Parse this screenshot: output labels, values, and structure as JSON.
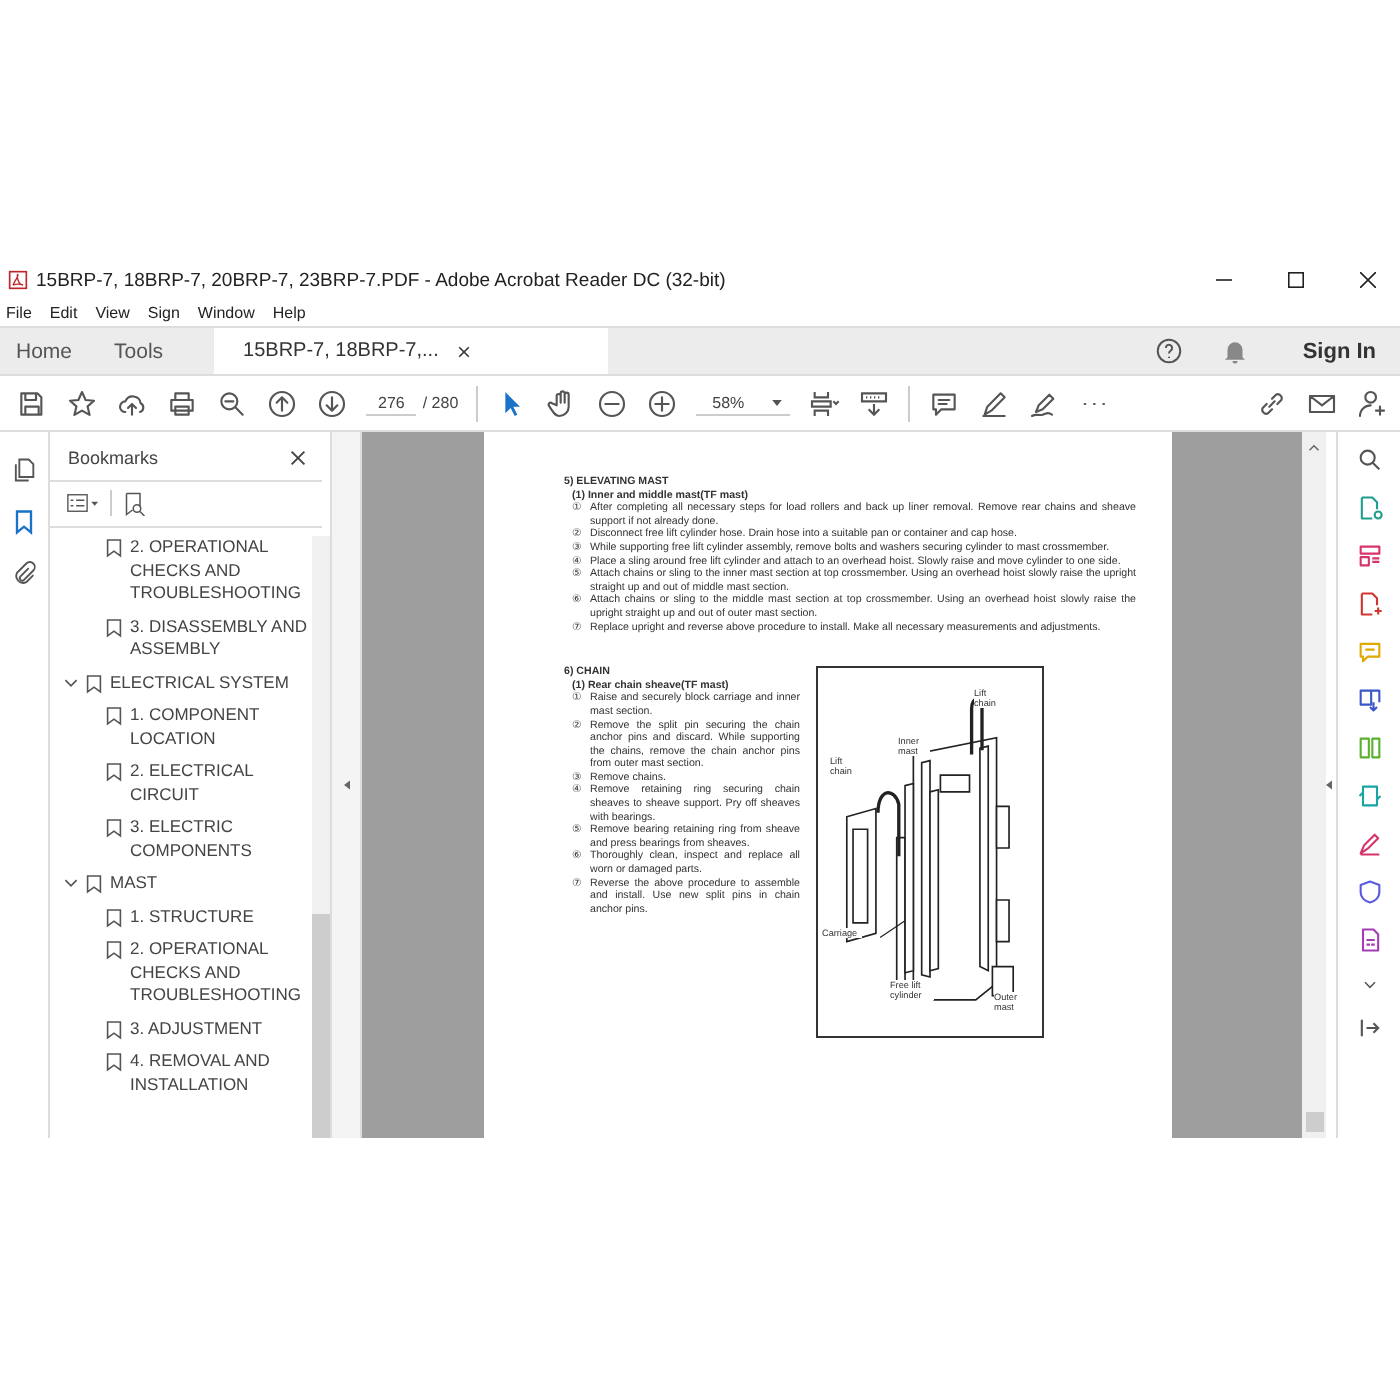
{
  "window": {
    "title": "15BRP-7, 18BRP-7, 20BRP-7, 23BRP-7.PDF - Adobe Acrobat Reader DC (32-bit)"
  },
  "menu": [
    "File",
    "Edit",
    "View",
    "Sign",
    "Window",
    "Help"
  ],
  "tabs": [
    {
      "label": "Home",
      "selected": false,
      "kind": "nav"
    },
    {
      "label": "Tools",
      "selected": false,
      "kind": "nav"
    },
    {
      "label": "15BRP-7, 18BRP-7,...",
      "selected": true,
      "kind": "document"
    }
  ],
  "sign_in": "Sign In",
  "toolbar": {
    "page": "276",
    "page_total": "/ 280",
    "zoom": "58%"
  },
  "bookmarks": {
    "title": "Bookmarks",
    "items": [
      {
        "children": [
          {
            "label": "2. OPERATIONAL CHECKS AND TROUBLESHOOTING"
          },
          {
            "label": "3. DISASSEMBLY AND ASSEMBLY"
          }
        ]
      },
      {
        "label": "ELECTRICAL SYSTEM",
        "expanded": true,
        "children": [
          {
            "label": "1. COMPONENT LOCATION"
          },
          {
            "label": "2. ELECTRICAL CIRCUIT"
          },
          {
            "label": "3. ELECTRIC COMPONENTS"
          }
        ]
      },
      {
        "label": "MAST",
        "expanded": true,
        "children": [
          {
            "label": "1. STRUCTURE"
          },
          {
            "label": "2. OPERATIONAL CHECKS AND TROUBLESHOOTING"
          },
          {
            "label": "3. ADJUSTMENT"
          },
          {
            "label": "4. REMOVAL AND INSTALLATION"
          }
        ]
      }
    ]
  },
  "page": {
    "sections": [
      {
        "heading": "5) ELEVATING MAST",
        "subheading": "(1) Inner and middle mast(TF mast)",
        "steps": [
          {
            "num": "①",
            "text": "After completing all necessary steps for load rollers and back up liner removal.  Remove rear chains and sheave support if not already done."
          },
          {
            "num": "②",
            "text": "Disconnect free lift cylinder hose.  Drain hose into a suitable pan or container and cap hose."
          },
          {
            "num": "③",
            "text": "While supporting free lift cylinder assembly, remove bolts and washers securing cylinder to mast crossmember."
          },
          {
            "num": "④",
            "text": "Place a sling around free lift cylinder and attach to an overhead hoist.  Slowly raise and move cylinder to one side."
          },
          {
            "num": "⑤",
            "text": "Attach chains or sling to the inner mast section at top crossmember.  Using an overhead hoist slowly raise the upright straight up and out of middle mast section."
          },
          {
            "num": "⑥",
            "text": "Attach chains or sling to the middle mast section at top crossmember.  Using an overhead hoist slowly raise the upright straight up and out of outer mast section."
          },
          {
            "num": "⑦",
            "text": "Replace upright and reverse above procedure to install.  Make all necessary measurements and adjustments."
          }
        ]
      },
      {
        "heading": "6) CHAIN",
        "subheading": "(1) Rear chain sheave(TF mast)",
        "steps": [
          {
            "num": "①",
            "text": "Raise and securely block carriage and inner mast section."
          },
          {
            "num": "②",
            "text": "Remove the split pin securing the chain anchor pins and discard.  While supporting the chains, remove the chain anchor pins from outer mast section."
          },
          {
            "num": "③",
            "text": "Remove chains."
          },
          {
            "num": "④",
            "text": "Remove retaining ring securing chain sheaves to sheave support.  Pry off sheaves with bearings."
          },
          {
            "num": "⑤",
            "text": "Remove bearing retaining ring from sheave and press bearings from sheaves."
          },
          {
            "num": "⑥",
            "text": "Thoroughly clean, inspect and replace all worn or damaged parts."
          },
          {
            "num": "⑦",
            "text": "Reverse the above procedure to assemble and install.  Use new split pins in chain anchor pins."
          }
        ],
        "figure_labels": [
          {
            "text": "Lift chain",
            "kind": "top-right"
          },
          {
            "text": "Inner mast",
            "kind": "inner"
          },
          {
            "text": "Lift chain",
            "kind": "left"
          },
          {
            "text": "Carriage",
            "kind": "carriage"
          },
          {
            "text": "Free lift cylinder",
            "kind": "cylinder"
          },
          {
            "text": "Outer mast",
            "kind": "outer"
          }
        ]
      }
    ]
  }
}
